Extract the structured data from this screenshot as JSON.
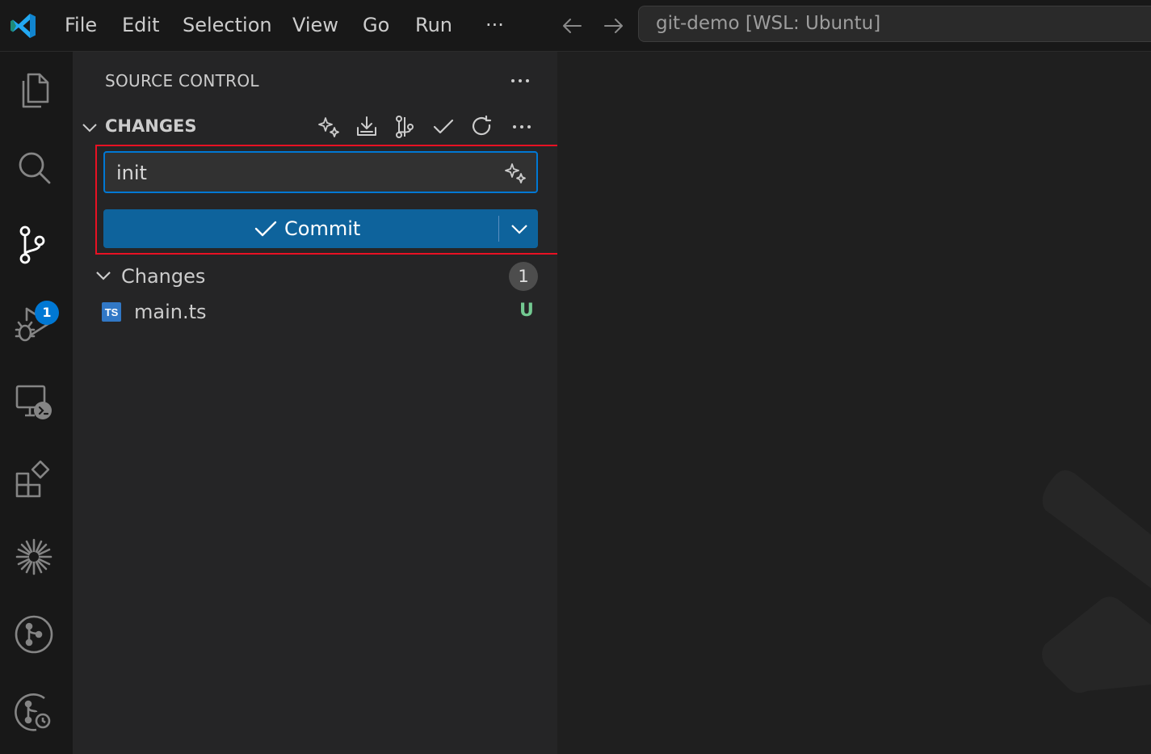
{
  "titlebar": {
    "menu": [
      "File",
      "Edit",
      "Selection",
      "View",
      "Go",
      "Run",
      "···"
    ],
    "command_center": "git-demo [WSL: Ubuntu]"
  },
  "activity_bar": {
    "icons": [
      "explorer-icon",
      "search-icon",
      "source-control-icon",
      "run-debug-icon",
      "remote-explorer-icon",
      "extensions-icon",
      "copilot-icon",
      "git-graph-icon",
      "git-history-icon"
    ],
    "source_control_badge": "1"
  },
  "sidebar": {
    "title": "SOURCE CONTROL",
    "section_title": "CHANGES",
    "commit_input_value": "init",
    "commit_button_label": "Commit",
    "changes_group": {
      "label": "Changes",
      "count": "1",
      "files": [
        {
          "icon_text": "TS",
          "name": "main.ts",
          "status": "U"
        }
      ]
    }
  },
  "colors": {
    "accent": "#0078d4",
    "commit_button": "#0e639c",
    "highlight_box": "#e81123",
    "untracked_status": "#73c991",
    "typescript_icon": "#3178c6"
  }
}
